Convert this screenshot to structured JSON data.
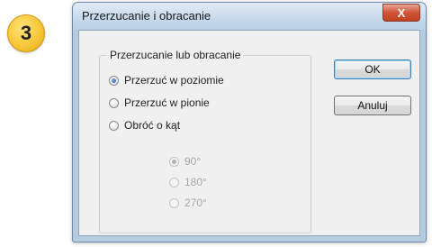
{
  "step": {
    "number": "3"
  },
  "dialog": {
    "title": "Przerzucanie i obracanie",
    "close_glyph": "X",
    "group_label": "Przerzucanie lub obracanie",
    "options": [
      {
        "label": "Przerzuć w poziomie",
        "checked": true,
        "enabled": true
      },
      {
        "label": "Przerzuć w pionie",
        "checked": false,
        "enabled": true
      },
      {
        "label": "Obróć o kąt",
        "checked": false,
        "enabled": true
      }
    ],
    "angles": [
      {
        "label": "90°",
        "checked": true,
        "enabled": false
      },
      {
        "label": "180°",
        "checked": false,
        "enabled": false
      },
      {
        "label": "270°",
        "checked": false,
        "enabled": false
      }
    ],
    "buttons": {
      "ok": "OK",
      "cancel": "Anuluj"
    }
  }
}
